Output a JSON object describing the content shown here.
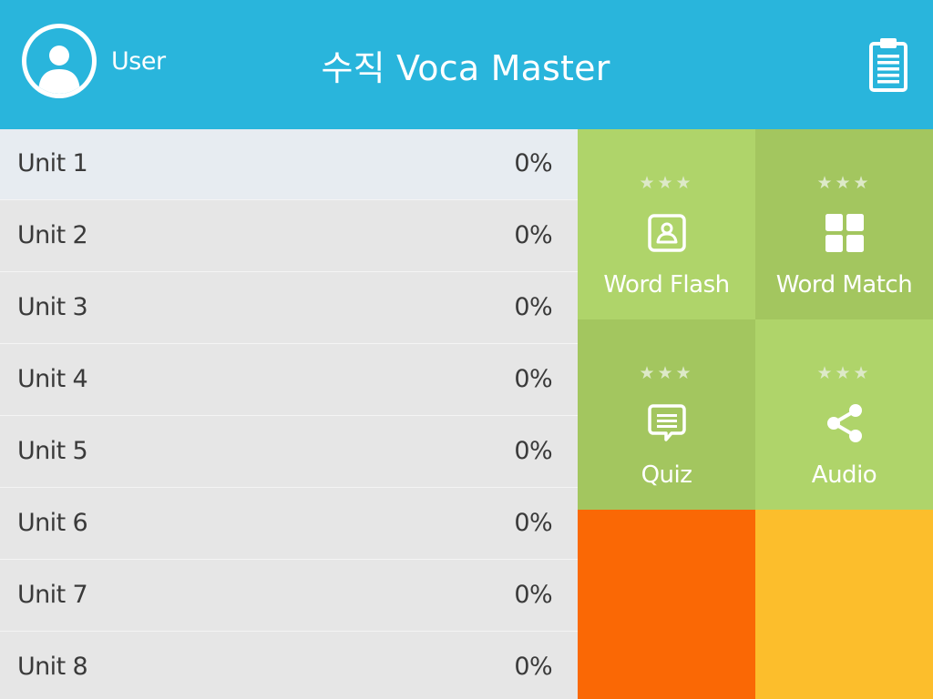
{
  "header": {
    "user_name": "User",
    "app_title": "수직 Voca Master",
    "icons": {
      "avatar": "user-avatar-icon",
      "right_button": "clipboard-icon"
    },
    "color": "#29b5dc"
  },
  "units": [
    {
      "label": "Unit 1",
      "progress": "0%",
      "selected": true
    },
    {
      "label": "Unit 2",
      "progress": "0%"
    },
    {
      "label": "Unit 3",
      "progress": "0%"
    },
    {
      "label": "Unit 4",
      "progress": "0%"
    },
    {
      "label": "Unit 5",
      "progress": "0%"
    },
    {
      "label": "Unit 6",
      "progress": "0%"
    },
    {
      "label": "Unit 7",
      "progress": "0%"
    },
    {
      "label": "Unit 8",
      "progress": "0%"
    }
  ],
  "modes": [
    {
      "label": "Word Flash",
      "stars": "★★★",
      "icon": "contact-card-icon",
      "color": "#afd46a"
    },
    {
      "label": "Word Match",
      "stars": "★★★",
      "icon": "grid-icon",
      "color": "#a3c65f"
    },
    {
      "label": "Quiz",
      "stars": "★★★",
      "icon": "chat-bubble-icon",
      "color": "#a3c65f"
    },
    {
      "label": "Audio",
      "stars": "★★★",
      "icon": "share-icon",
      "color": "#afd46a"
    }
  ],
  "extra_tiles": [
    {
      "color": "#fa6805"
    },
    {
      "color": "#fcbe2c"
    }
  ]
}
